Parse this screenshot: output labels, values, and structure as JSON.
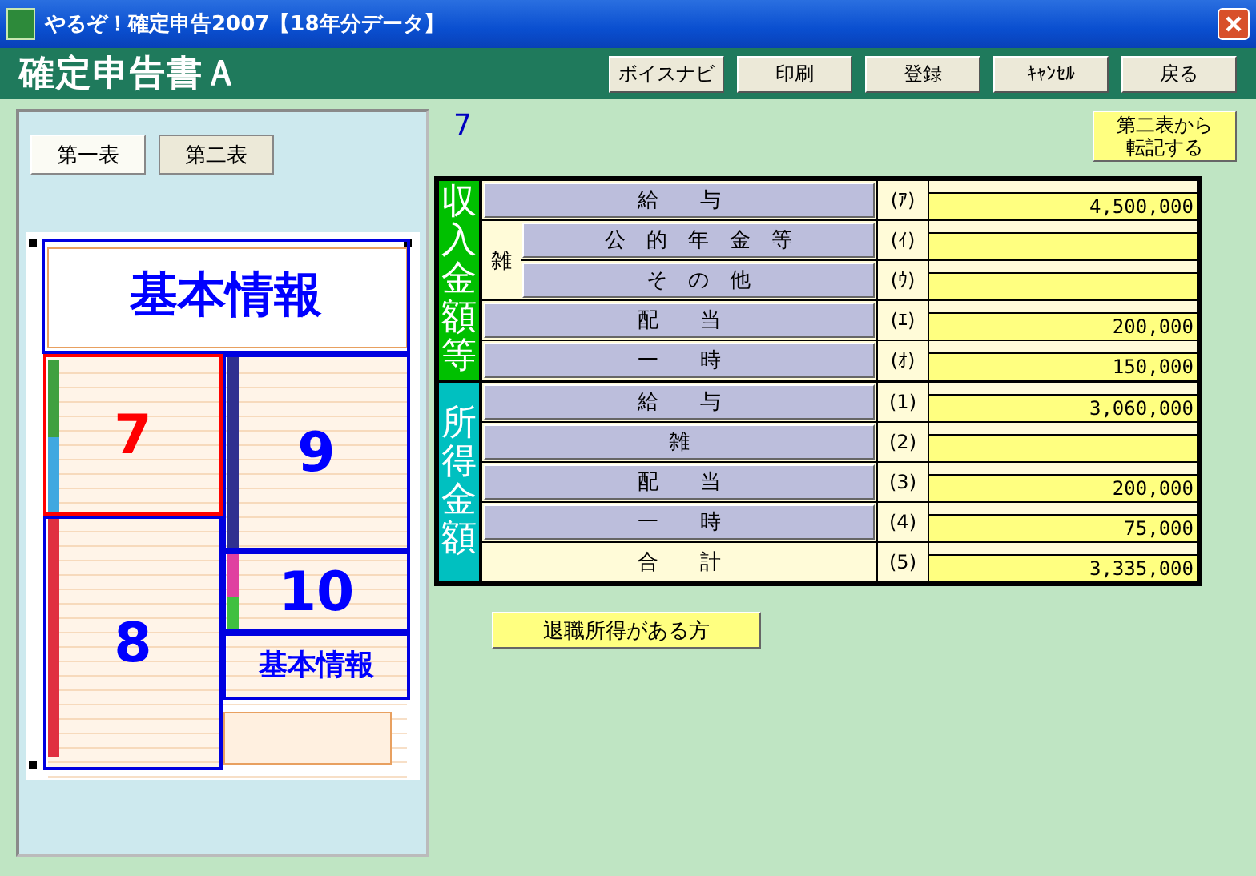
{
  "window": {
    "title": "やるぞ！確定申告2007【18年分データ】"
  },
  "header": {
    "title": "確定申告書Ａ",
    "buttons": [
      "ボイスナビ",
      "印刷",
      "登録",
      "ｷｬﾝｾﾙ",
      "戻る"
    ]
  },
  "sheet_tabs": [
    {
      "label": "第一表",
      "selected": true
    },
    {
      "label": "第二表",
      "selected": false
    }
  ],
  "form_sections": [
    {
      "label": "基本情報",
      "selected": false
    },
    {
      "label": "7",
      "selected": true
    },
    {
      "label": "9",
      "selected": false
    },
    {
      "label": "10",
      "selected": false
    },
    {
      "label": "8",
      "selected": false
    },
    {
      "label": "基本情報",
      "selected": false
    }
  ],
  "section_number": "7",
  "transfer_button": [
    "第二表から",
    "転記する"
  ],
  "groups": [
    {
      "label": "収入金額等",
      "color": "#00c000",
      "rows": [
        {
          "kind": "item",
          "label": "給　　与",
          "code": "(ｱ)",
          "value": "4,500,000"
        },
        {
          "kind": "split",
          "label": "雑",
          "children": [
            {
              "label": "公　的　年　金　等",
              "code": "(ｲ)"
            },
            {
              "label": "そ　の　他",
              "code": "(ｳ)"
            }
          ]
        },
        {
          "kind": "item",
          "label": "配　　当",
          "code": "(ｴ)",
          "value": "200,000"
        },
        {
          "kind": "item",
          "label": "一　　時",
          "code": "(ｵ)",
          "value": "150,000"
        }
      ]
    },
    {
      "label": "所得金額",
      "color": "#00c0c0",
      "rows": [
        {
          "kind": "item",
          "label": "給　　与",
          "code": "(1)",
          "value": "3,060,000"
        },
        {
          "kind": "item",
          "label": "雑",
          "code": "(2)"
        },
        {
          "kind": "item",
          "label": "配　　当",
          "code": "(3)",
          "value": "200,000"
        },
        {
          "kind": "item",
          "label": "一　　時",
          "code": "(4)",
          "value": "75,000"
        },
        {
          "kind": "total",
          "label": "合　　計",
          "code": "(5)",
          "value": "3,335,000"
        }
      ]
    }
  ],
  "retirement_button": "退職所得がある方"
}
